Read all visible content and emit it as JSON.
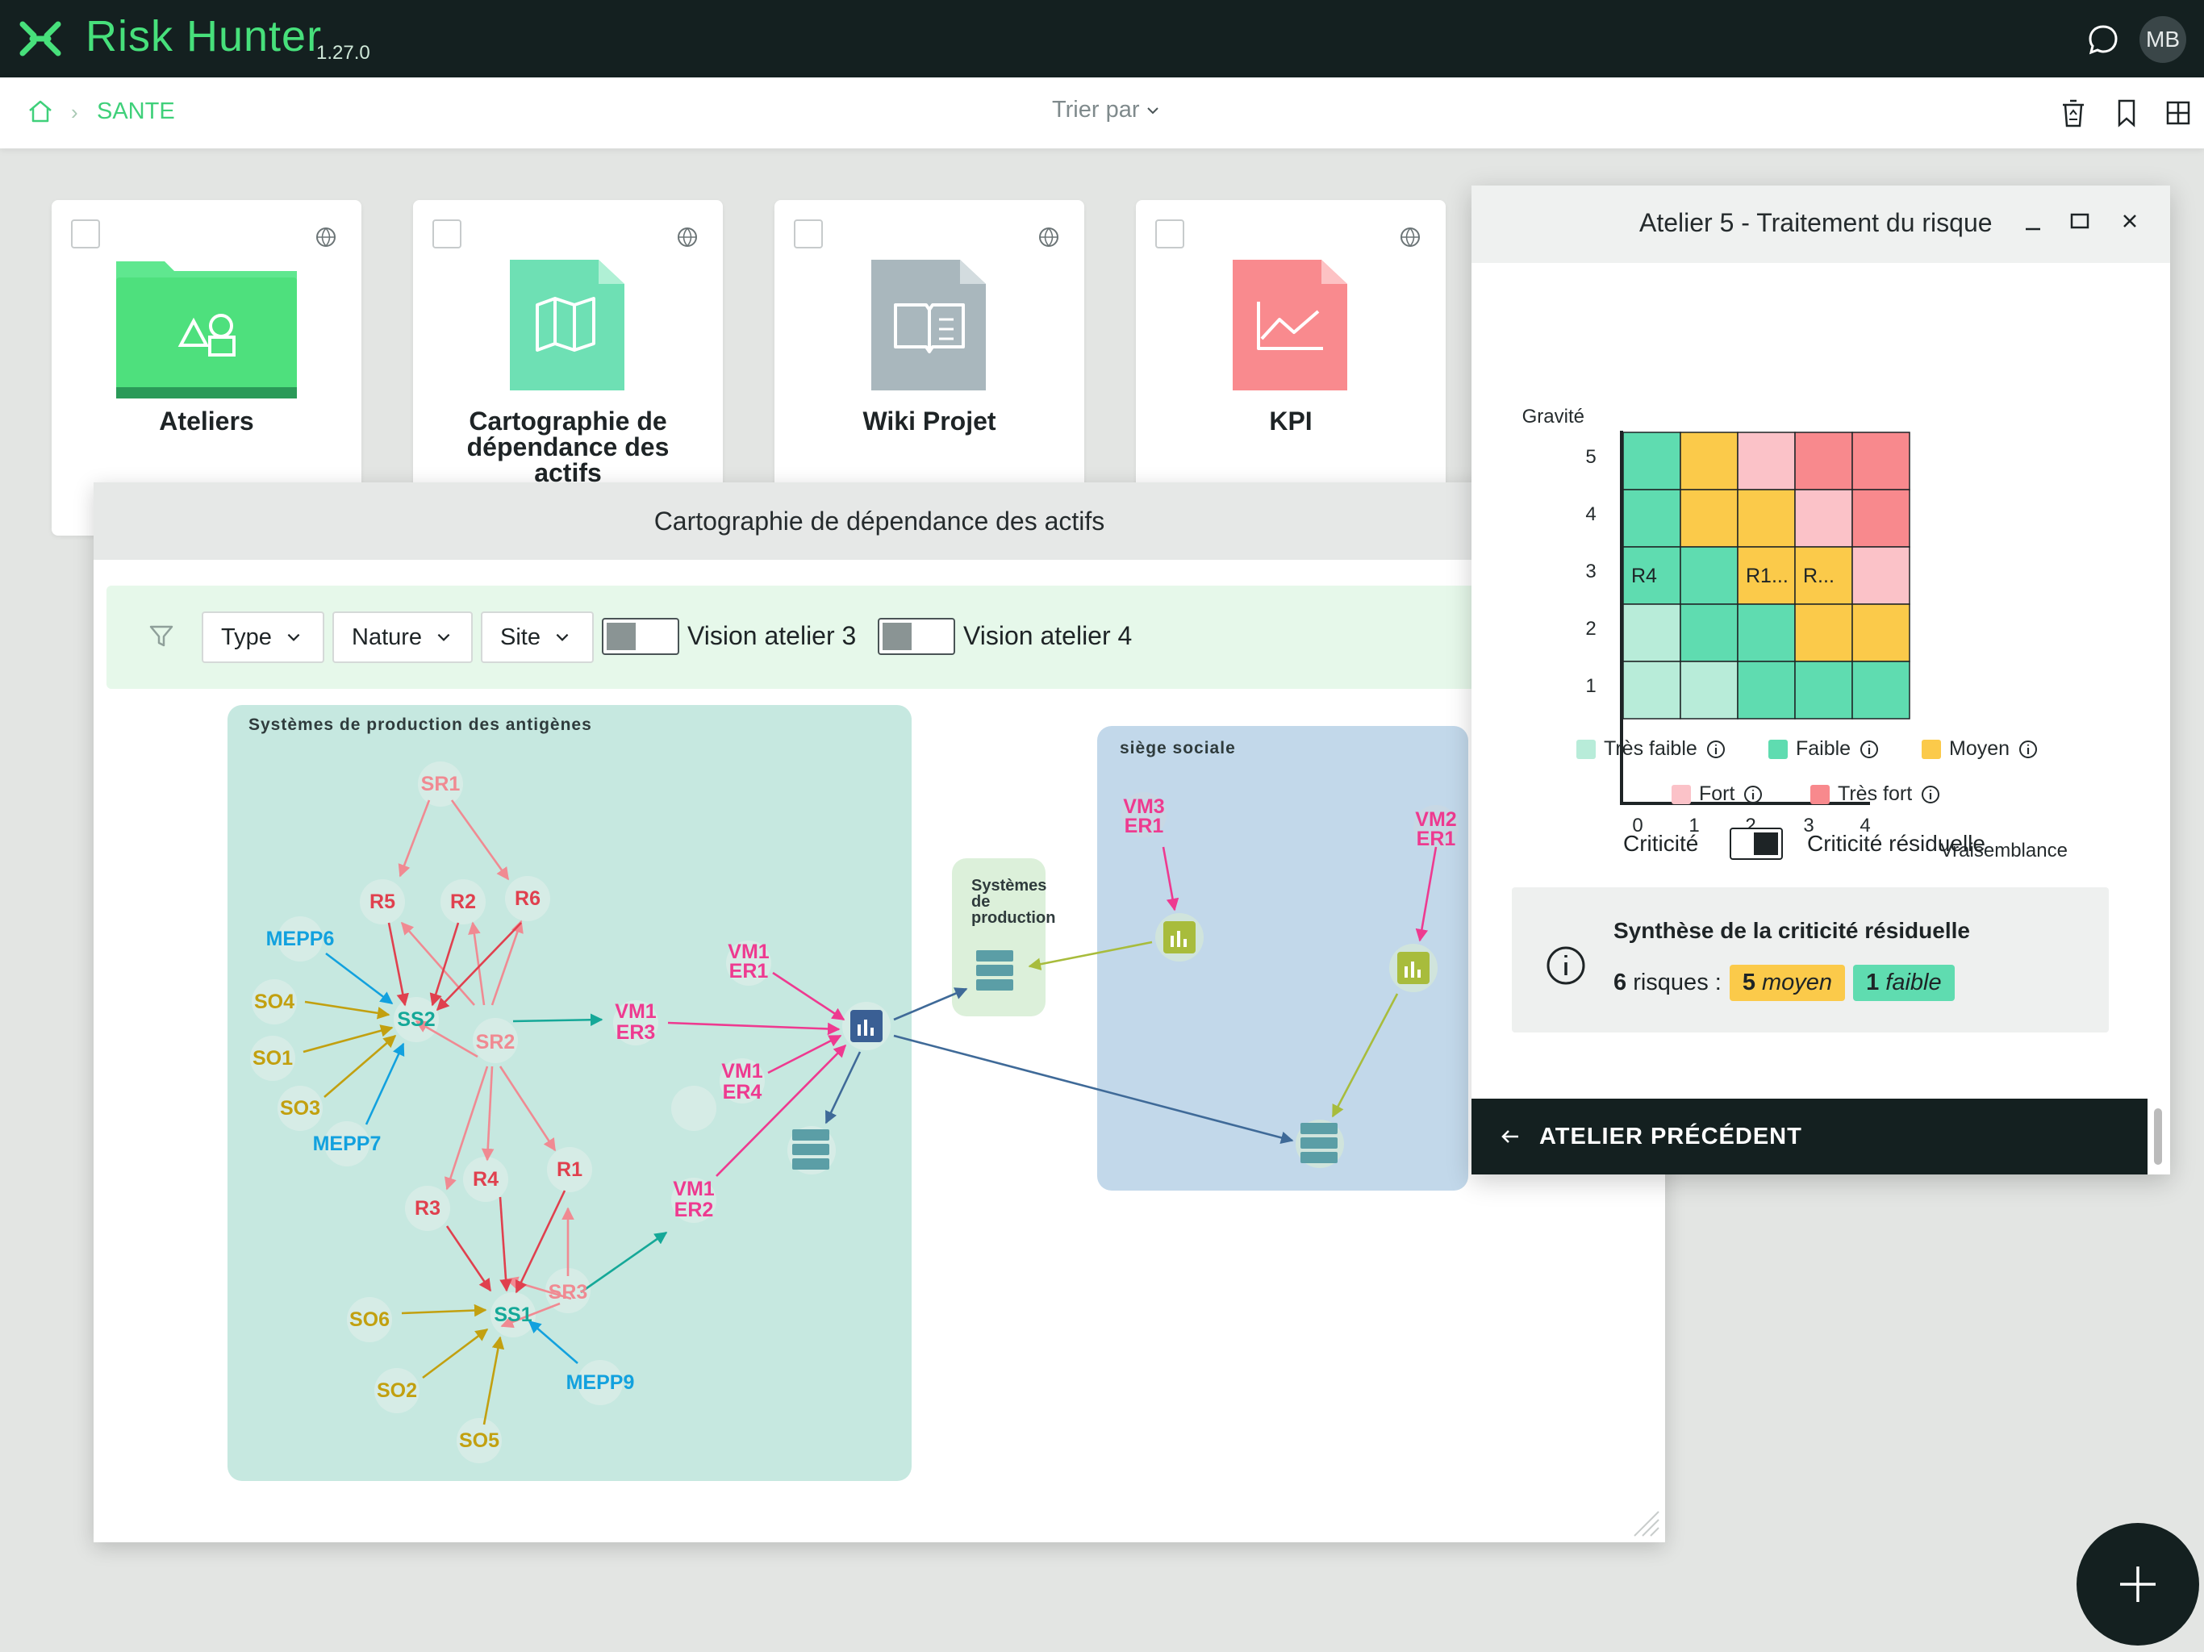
{
  "app": {
    "title": "Risk Hunter",
    "version": "1.27.0",
    "user_initials": "MB"
  },
  "breadcrumb": {
    "item": "SANTE"
  },
  "toolbar": {
    "sort_label": "Trier par"
  },
  "cards": [
    {
      "title_lines": [
        "Ateliers"
      ],
      "icon": "folder-shapes-icon",
      "color": "#4ee07d"
    },
    {
      "title_lines": [
        "Cartographie de",
        "dépendance des",
        "actifs"
      ],
      "icon": "map-icon",
      "color": "#6ee0b4"
    },
    {
      "title_lines": [
        "Wiki Projet"
      ],
      "icon": "book-icon",
      "color": "#a9b7bd"
    },
    {
      "title_lines": [
        "KPI"
      ],
      "icon": "chart-line-icon",
      "color": "#f98a8e"
    }
  ],
  "map_window": {
    "title": "Cartographie de dépendance des actifs",
    "filters": [
      "Type",
      "Nature",
      "Site"
    ],
    "toggles": [
      "Vision atelier 3",
      "Vision atelier 4"
    ],
    "groups": [
      "Systèmes de production des antigènes",
      "siège sociale"
    ],
    "subgroup": [
      "Systèmes",
      "de",
      "production"
    ],
    "nodes": {
      "sr": [
        "SR1",
        "SR2",
        "SR3"
      ],
      "risks": [
        "R1",
        "R2",
        "R3",
        "R4",
        "R5",
        "R6"
      ],
      "mepp": [
        "MEPP6",
        "MEPP7",
        "MEPP9"
      ],
      "so": [
        "SO1",
        "SO2",
        "SO3",
        "SO4",
        "SO5",
        "SO6"
      ],
      "ss": [
        "SS1",
        "SS2"
      ],
      "vm_er": [
        [
          "VM1",
          "ER1"
        ],
        [
          "VM1",
          "ER3"
        ],
        [
          "VM1",
          "ER4"
        ],
        [
          "VM1",
          "ER2"
        ],
        [
          "VM3",
          "ER1"
        ],
        [
          "VM2",
          "ER1"
        ]
      ]
    }
  },
  "atelier_panel": {
    "title": "Atelier 5 - Traitement du risque",
    "matrix": {
      "ylabel": "Gravité",
      "xlabel": "Vraisemblance",
      "x_ticks": [
        "0",
        "1",
        "2",
        "3",
        "4"
      ],
      "y_ticks": [
        "5",
        "4",
        "3",
        "2",
        "1"
      ],
      "grid_levels": [
        [
          "faible",
          "moyen",
          "fort",
          "tres_fort",
          "tres_fort"
        ],
        [
          "faible",
          "moyen",
          "moyen",
          "fort",
          "tres_fort"
        ],
        [
          "faible",
          "faible",
          "moyen",
          "moyen",
          "fort"
        ],
        [
          "tres_faible",
          "faible",
          "faible",
          "moyen",
          "moyen"
        ],
        [
          "tres_faible",
          "tres_faible",
          "faible",
          "faible",
          "faible"
        ]
      ],
      "cell_labels": [
        {
          "row": 2,
          "col": 0,
          "text": "R4"
        },
        {
          "row": 2,
          "col": 2,
          "text": "R1..."
        },
        {
          "row": 2,
          "col": 3,
          "text": "R..."
        }
      ]
    },
    "colors": {
      "tres_faible": "#b8ecd9",
      "faible": "#5fdcb0",
      "moyen": "#fbca4a",
      "fort": "#fbc2c8",
      "tres_fort": "#f8898d"
    },
    "legend": [
      {
        "label": "Très faible",
        "key": "tres_faible"
      },
      {
        "label": "Faible",
        "key": "faible"
      },
      {
        "label": "Moyen",
        "key": "moyen"
      },
      {
        "label": "Fort",
        "key": "fort"
      },
      {
        "label": "Très fort",
        "key": "tres_fort"
      }
    ],
    "criticite_label": "Criticité",
    "criticite_residuelle_label": "Criticité résiduelle",
    "synthese": {
      "title": "Synthèse de la criticité résiduelle",
      "count": "6",
      "count_suffix": "risques :",
      "moyen_count": "5",
      "moyen_label": "moyen",
      "faible_count": "1",
      "faible_label": "faible"
    },
    "prev_button": "ATELIER PRÉCÉDENT"
  }
}
